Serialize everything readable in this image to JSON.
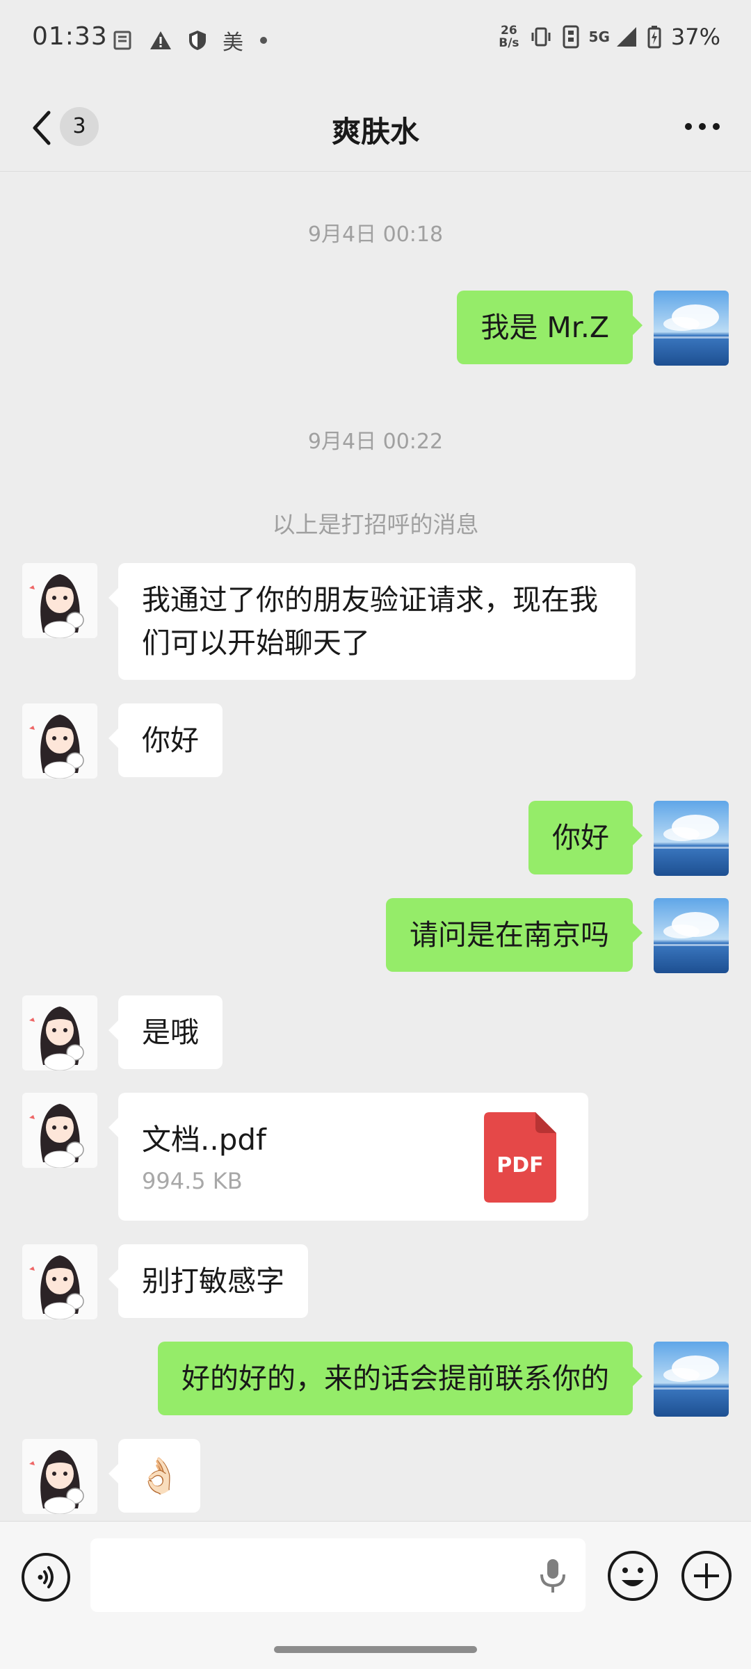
{
  "status_bar": {
    "time": "01:33",
    "carrier_tag": "美",
    "net_speed_top": "26",
    "net_speed_bottom": "B/s",
    "network": "5G",
    "battery": "37%"
  },
  "header": {
    "unread_count": "3",
    "title": "爽肤水"
  },
  "chat": {
    "timestamps": [
      "9月4日 00:18",
      "9月4日 00:22"
    ],
    "system_message": "以上是打招呼的消息",
    "messages": [
      {
        "side": "right",
        "text": "我是 Mr.Z"
      },
      {
        "side": "left",
        "text": "我通过了你的朋友验证请求，现在我们可以开始聊天了"
      },
      {
        "side": "left",
        "text": "你好"
      },
      {
        "side": "right",
        "text": "你好"
      },
      {
        "side": "right",
        "text": "请问是在南京吗"
      },
      {
        "side": "left",
        "text": "是哦"
      },
      {
        "side": "left",
        "type": "file",
        "file_name": "文档..pdf",
        "file_size": "994.5 KB",
        "file_icon_label": "PDF"
      },
      {
        "side": "left",
        "text": "别打敏感字"
      },
      {
        "side": "right",
        "text": "好的好的，来的话会提前联系你的"
      },
      {
        "side": "left",
        "text": "👌🏻"
      }
    ]
  },
  "colors": {
    "outgoing_bubble": "#95ec69",
    "incoming_bubble": "#ffffff",
    "background": "#ededed",
    "pdf_red": "#e54848"
  },
  "input_bar": {
    "placeholder": ""
  }
}
